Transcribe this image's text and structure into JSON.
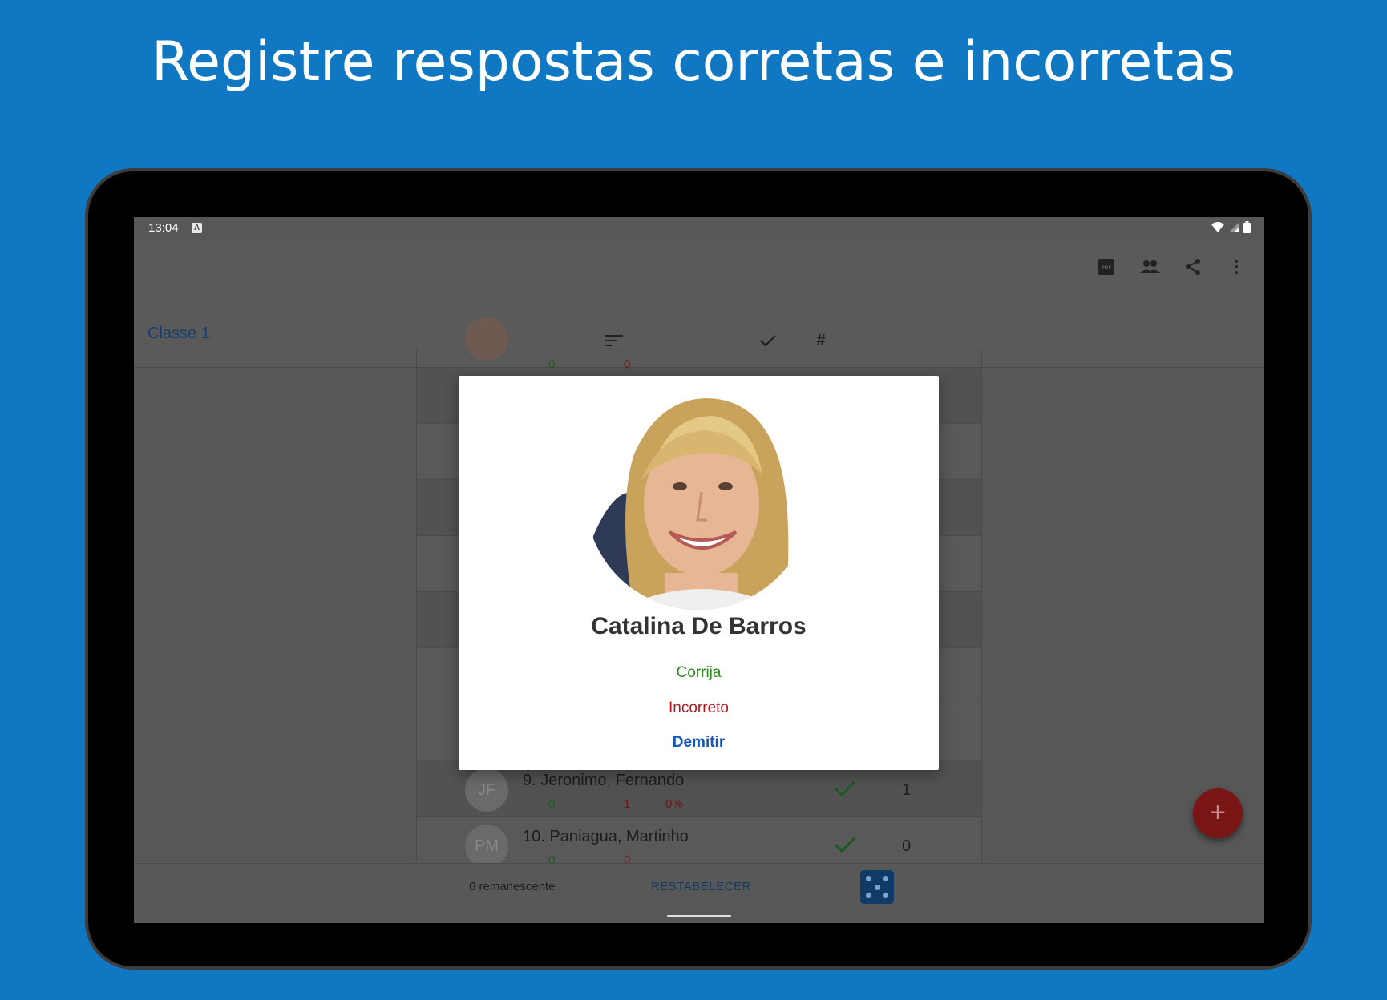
{
  "headline": "Registre respostas corretas e incorretas",
  "status_bar": {
    "time": "13:04",
    "notification_badge": "A"
  },
  "app_bar": {
    "class_name": "Classe 1",
    "actions": [
      "pdf-icon",
      "people-icon",
      "share-icon",
      "more-vert-icon"
    ],
    "columns": [
      "image-icon",
      "sort-icon",
      "check-icon",
      "#"
    ]
  },
  "list": {
    "rows": [
      {
        "name": "",
        "initials": "",
        "correct": "0",
        "incorrect": "0",
        "percent": "",
        "count": ""
      },
      {
        "name": "9. Jeronimo, Fernando",
        "initials": "JF",
        "correct": "0",
        "incorrect": "1",
        "percent": "0%",
        "count": "1"
      },
      {
        "name": "10. Paniagua, Martinho",
        "initials": "PM",
        "correct": "0",
        "incorrect": "0",
        "percent": "",
        "count": "0"
      }
    ]
  },
  "bottom_bar": {
    "remaining": "6 remanescente",
    "reset": "RESTABELECER"
  },
  "fab": {
    "label": "+"
  },
  "dialog": {
    "student_name": "Catalina De Barros",
    "correct_label": "Corrija",
    "incorrect_label": "Incorreto",
    "dismiss_label": "Demitir"
  },
  "colors": {
    "background": "#1078c2",
    "correct": "#2a8a1e",
    "incorrect": "#b3171d",
    "dismiss": "#1554b8",
    "fab": "#7a1515"
  }
}
